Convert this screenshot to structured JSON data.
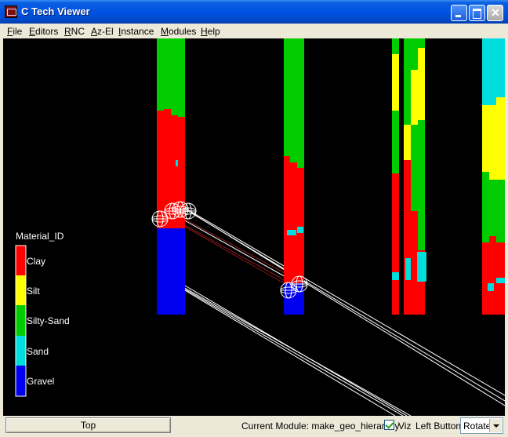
{
  "window": {
    "title": "C Tech Viewer"
  },
  "menu": {
    "items": [
      "File",
      "Editors",
      "RNC",
      "Az-El",
      "Instance",
      "Modules",
      "Help"
    ]
  },
  "legend": {
    "title": "Material_ID",
    "entries": [
      {
        "label": "Clay",
        "color": "#ff0000"
      },
      {
        "label": "Silt",
        "color": "#ffff00"
      },
      {
        "label": "Silty-Sand",
        "color": "#00cc00"
      },
      {
        "label": "Sand",
        "color": "#00dddd"
      },
      {
        "label": "Gravel",
        "color": "#0000ee"
      }
    ]
  },
  "colors": {
    "viewport_bg": "#000000",
    "wire": "#ffffff",
    "wire_dark": "#8b1a1a"
  },
  "statusbar": {
    "view_button": "Top",
    "current_module_label": "Current Module: make_geo_hierarchy",
    "viz_label": "Viz",
    "viz_checked": true,
    "left_button_label": "Left Button",
    "left_button_mode": "Rotate"
  }
}
